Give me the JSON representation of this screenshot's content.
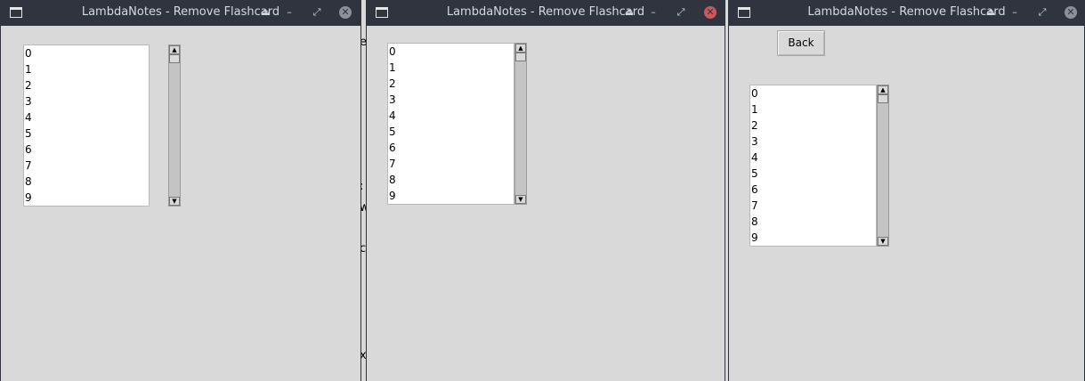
{
  "windows": [
    {
      "title": "LambdaNotes - Remove Flashcard",
      "controls": {
        "eject": "⏏",
        "minimize": "–",
        "restore": "⤢",
        "close": "✕"
      },
      "list_items": [
        "0",
        "1",
        "2",
        "3",
        "4",
        "5",
        "6",
        "7",
        "8",
        "9"
      ]
    },
    {
      "title": "LambdaNotes - Remove Flashcard",
      "controls": {
        "eject": "⏏",
        "minimize": "–",
        "restore": "⤢",
        "close": "✕"
      },
      "list_items": [
        "0",
        "1",
        "2",
        "3",
        "4",
        "5",
        "6",
        "7",
        "8",
        "9"
      ]
    },
    {
      "title": "LambdaNotes - Remove Flashcard",
      "controls": {
        "eject": "⏏",
        "minimize": "–",
        "restore": "⤢",
        "close": "✕"
      },
      "back_label": "Back",
      "list_items": [
        "0",
        "1",
        "2",
        "3",
        "4",
        "5",
        "6",
        "7",
        "8",
        "9"
      ]
    }
  ],
  "scroll_arrows": {
    "up": "▲",
    "down": "▼"
  },
  "background_fragments": [
    "e",
    ":",
    "w",
    "c",
    "x"
  ],
  "colors": {
    "titlebar": "#2f343f",
    "window_bg": "#d9d9d9",
    "close_active": "#cc575d"
  }
}
